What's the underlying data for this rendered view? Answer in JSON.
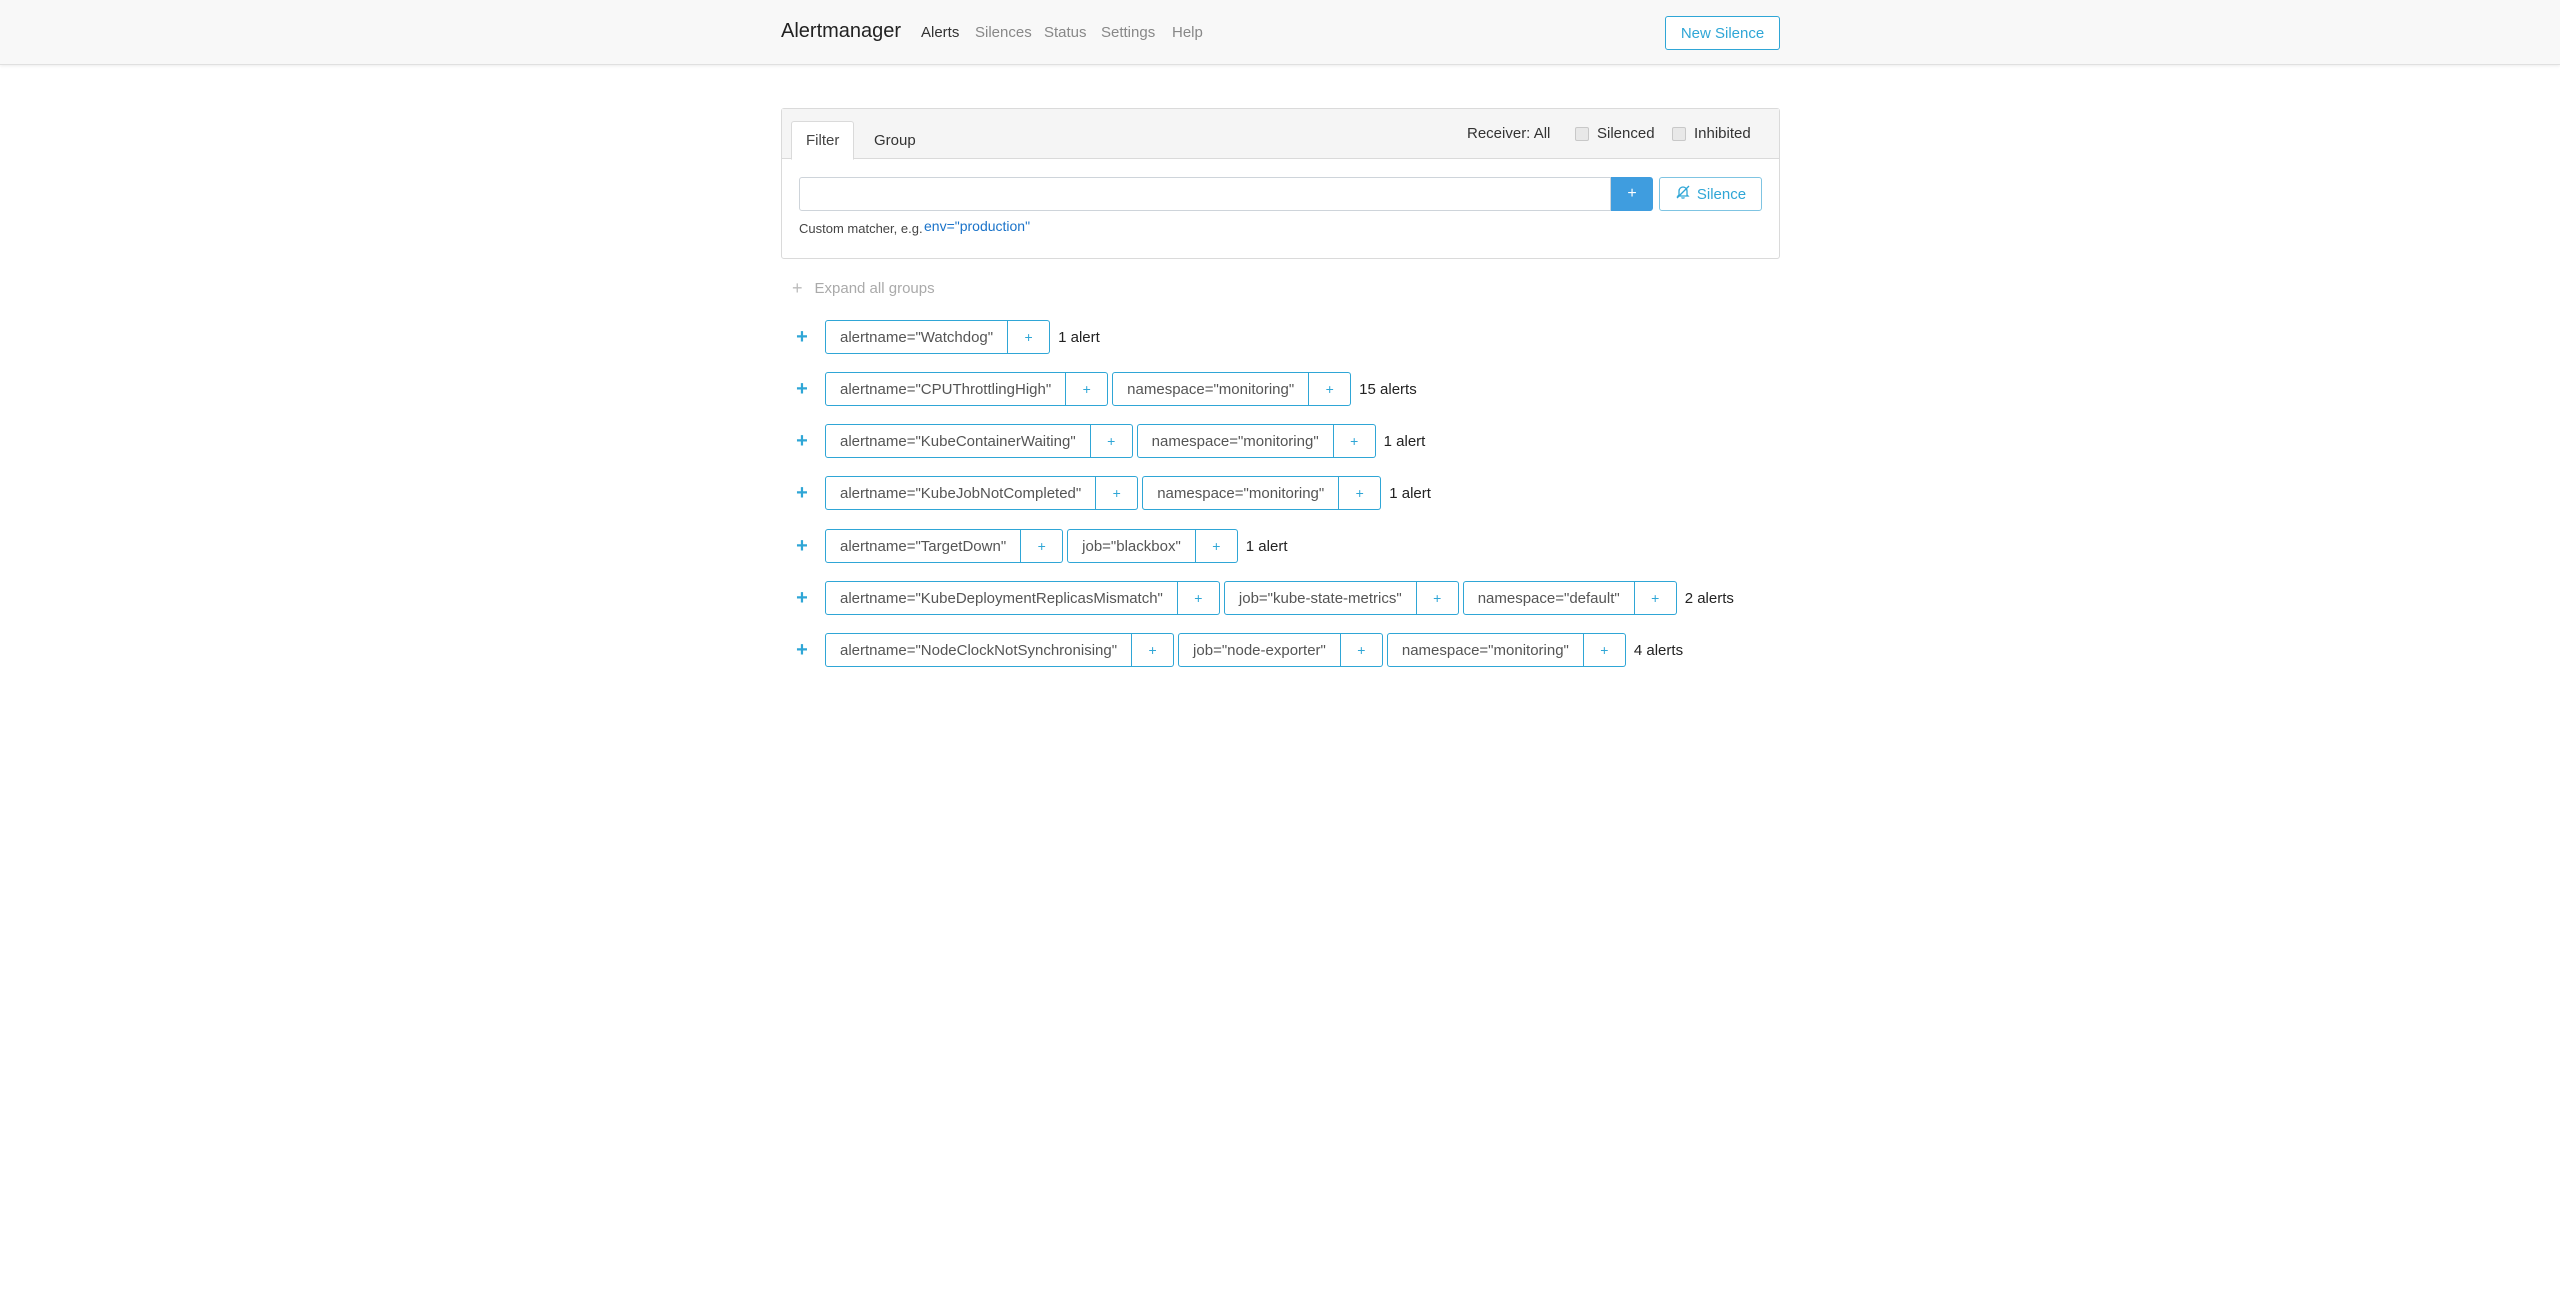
{
  "nav": {
    "brand": "Alertmanager",
    "links": [
      "Alerts",
      "Silences",
      "Status",
      "Settings",
      "Help"
    ],
    "new_silence": "New Silence"
  },
  "filter": {
    "tabs": [
      "Filter",
      "Group"
    ],
    "receiver": "Receiver: All",
    "silenced_label": "Silenced",
    "inhibited_label": "Inhibited",
    "input_value": "",
    "add_label": "+",
    "silence_label": "Silence",
    "helper_text": "Custom matcher, e.g.",
    "helper_example": "env=\"production\""
  },
  "expand_all": {
    "icon": "+",
    "label": "Expand all groups"
  },
  "groups": [
    {
      "labels": [
        "alertname=\"Watchdog\""
      ],
      "count": "1 alert"
    },
    {
      "labels": [
        "alertname=\"CPUThrottlingHigh\"",
        "namespace=\"monitoring\""
      ],
      "count": "15 alerts"
    },
    {
      "labels": [
        "alertname=\"KubeContainerWaiting\"",
        "namespace=\"monitoring\""
      ],
      "count": "1 alert"
    },
    {
      "labels": [
        "alertname=\"KubeJobNotCompleted\"",
        "namespace=\"monitoring\""
      ],
      "count": "1 alert"
    },
    {
      "labels": [
        "alertname=\"TargetDown\"",
        "job=\"blackbox\""
      ],
      "count": "1 alert"
    },
    {
      "labels": [
        "alertname=\"KubeDeploymentReplicasMismatch\"",
        "job=\"kube-state-metrics\"",
        "namespace=\"default\""
      ],
      "count": "2 alerts"
    },
    {
      "labels": [
        "alertname=\"NodeClockNotSynchronising\"",
        "job=\"node-exporter\"",
        "namespace=\"monitoring\""
      ],
      "count": "4 alerts"
    }
  ],
  "colors": {
    "accent": "#2fa6d6",
    "primary_button": "#3f9ddf"
  }
}
